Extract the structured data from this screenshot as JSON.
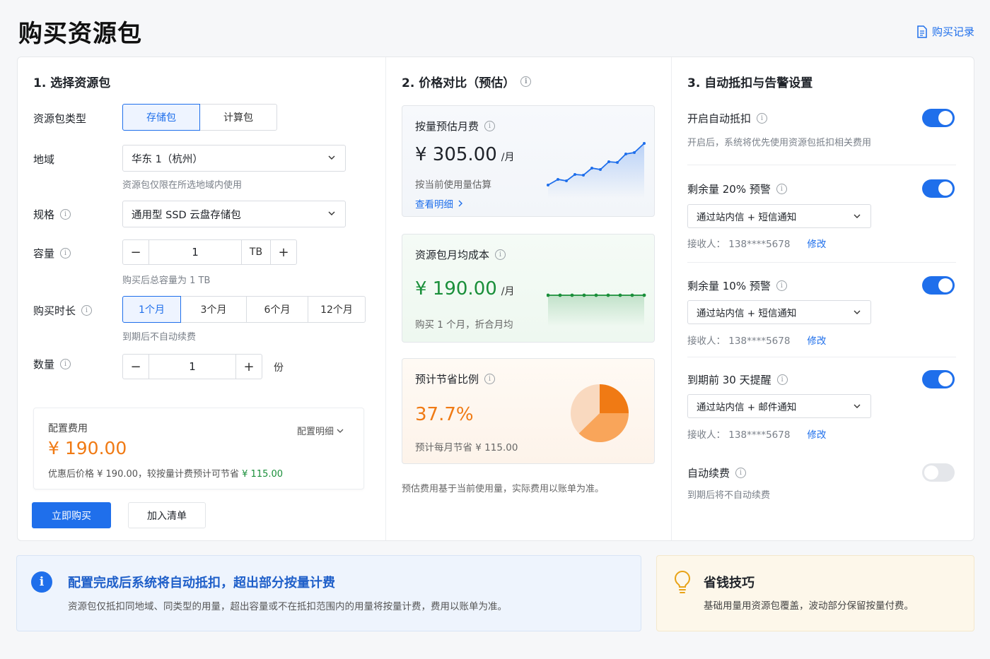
{
  "header": {
    "title": "购买资源包",
    "records_link": "购买记录"
  },
  "section1": {
    "title": "1. 选择资源包",
    "type_label": "资源包类型",
    "type_options": [
      "存储包",
      "计算包"
    ],
    "type_selected": "存储包",
    "region_label": "地域",
    "region_value": "华东 1（杭州）",
    "region_hint": "资源包仅限在所选地域内使用",
    "spec_label": "规格",
    "spec_value": "通用型 SSD 云盘存储包",
    "capacity_label": "容量",
    "capacity_value": "1",
    "capacity_unit": "TB",
    "capacity_hint": "购买后总容量为 1 TB",
    "duration_label": "购买时长",
    "duration_options": [
      "1个月",
      "3个月",
      "6个月",
      "12个月"
    ],
    "duration_selected": "1个月",
    "duration_hint": "到期后不自动续费",
    "quantity_label": "数量",
    "quantity_value": "1",
    "quantity_unit": "份",
    "fee": {
      "label": "配置费用",
      "detail_link": "配置明细",
      "amount": "¥ 190.00",
      "note_prefix": "优惠后价格 ¥ 190.00，较按量计费预计可节省 ",
      "note_saving": "¥ 115.00"
    },
    "buy_button": "立即购买",
    "cart_button": "加入清单"
  },
  "section2": {
    "title": "2. 价格对比（预估）",
    "card_payg": {
      "title": "按量预估月费",
      "price": "¥ 305.00",
      "per": "/月",
      "sub": "按当前使用量估算",
      "link": "查看明细"
    },
    "card_pack": {
      "title": "资源包月均成本",
      "price": "¥ 190.00",
      "per": "/月",
      "sub": "购买 1 个月，折合月均"
    },
    "card_saving": {
      "title": "预计节省比例",
      "percent": "37.7%",
      "percent_value": 37.7,
      "sub": "预计每月节省 ¥ 115.00"
    },
    "footnote": "预估费用基于当前使用量，实际费用以账单为准。"
  },
  "section3": {
    "title": "3. 自动抵扣与告警设置",
    "auto_deduct": {
      "label": "开启自动抵扣",
      "desc": "开启后，系统将优先使用资源包抵扣相关费用",
      "enabled": true
    },
    "alerts": [
      {
        "label": "剩余量 20% 预警",
        "channel": "通过站内信 + 短信通知",
        "receiver_label": "接收人：",
        "receiver": "138****5678",
        "edit": "修改",
        "enabled": true
      },
      {
        "label": "剩余量 10% 预警",
        "channel": "通过站内信 + 短信通知",
        "receiver_label": "接收人：",
        "receiver": "138****5678",
        "edit": "修改",
        "enabled": true
      },
      {
        "label": "到期前 30 天提醒",
        "channel": "通过站内信 + 邮件通知",
        "receiver_label": "接收人：",
        "receiver": "138****5678",
        "edit": "修改",
        "enabled": true
      }
    ],
    "auto_renew": {
      "label": "自动续费",
      "desc": "到期后将不自动续费",
      "enabled": false
    }
  },
  "banner_info": {
    "title": "配置完成后系统将自动抵扣，超出部分按量计费",
    "text": "资源包仅抵扣同地域、同类型的用量，超出容量或不在抵扣范围内的用量将按量计费，费用以账单为准。"
  },
  "banner_tip": {
    "title": "省钱技巧",
    "text": "基础用量用资源包覆盖，波动部分保留按量付费。"
  },
  "colors": {
    "primary": "#1f6feb",
    "orange": "#f07a14",
    "green": "#1a8f3a"
  }
}
